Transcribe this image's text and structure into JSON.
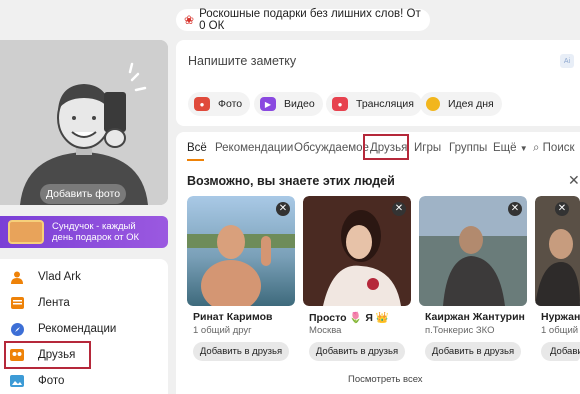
{
  "promo": {
    "text": "Роскошные подарки без лишних слов! От 0 ОК",
    "icon": "rose-icon"
  },
  "profile": {
    "add_photo": "Добавить фото"
  },
  "chest": {
    "line1": "Сундучок - каждый",
    "line2": "день подарок от ОК"
  },
  "nav": {
    "items": [
      {
        "label": "Vlad Ark",
        "icon": "user-icon"
      },
      {
        "label": "Лента",
        "icon": "feed-icon"
      },
      {
        "label": "Рекомендации",
        "icon": "compass-icon"
      },
      {
        "label": "Друзья",
        "icon": "friends-icon"
      },
      {
        "label": "Фото",
        "icon": "photo-icon"
      }
    ]
  },
  "note": {
    "placeholder": "Напишите заметку",
    "ai_badge": "Ai"
  },
  "post_chips": [
    {
      "label": "Фото",
      "color": "#e04a3b"
    },
    {
      "label": "Видео",
      "color": "#8a49e0"
    },
    {
      "label": "Трансляция",
      "color": "#e7424f"
    },
    {
      "label": "Идея дня",
      "color": "#f2b61d"
    }
  ],
  "tabs": [
    "Всё",
    "Рекомендации",
    "Обсуждаемое",
    "Друзья",
    "Игры",
    "Группы",
    "Ещё",
    "Поиск"
  ],
  "section": {
    "title": "Возможно, вы знаете этих людей",
    "see_all": "Посмотреть всех"
  },
  "people": [
    {
      "name": "Ринат Каримов",
      "sub": "1 общий друг",
      "button": "Добавить в друзья"
    },
    {
      "name": "Просто 🌷 Я 👑",
      "sub": "Москва",
      "button": "Добавить в друзья"
    },
    {
      "name": "Каиржан Жантурин",
      "sub": "п.Тонкерис ЗКО",
      "button": "Добавить в друзья"
    },
    {
      "name": "Нуржан Ж",
      "sub": "1 общий",
      "button": "Добавить"
    }
  ],
  "colors": {
    "accent": "#ee8208",
    "highlight": "#b5283a"
  }
}
